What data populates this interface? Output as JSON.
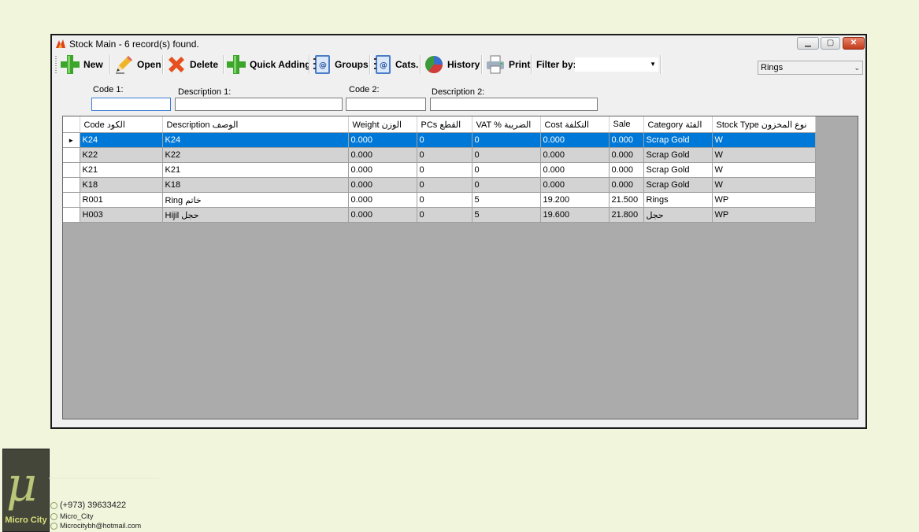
{
  "window": {
    "title": "Stock Main - 6 record(s) found."
  },
  "toolbar": {
    "new": "New",
    "open": "Open",
    "delete": "Delete",
    "quick_adding": "Quick Adding",
    "groups": "Groups",
    "cats": "Cats.",
    "history": "History",
    "print": "Print",
    "filter_by": "Filter by:",
    "filter_value": ""
  },
  "type_combo": {
    "value": "Rings"
  },
  "search": {
    "code1_label": "Code 1:",
    "desc1_label": "Description 1:",
    "code2_label": "Code 2:",
    "desc2_label": "Description 2:",
    "code1_value": "",
    "desc1_value": "",
    "code2_value": "",
    "desc2_value": ""
  },
  "grid": {
    "columns": [
      "Code الكود",
      "Description الوصف",
      "Weight الوزن",
      "PCs القطع",
      "VAT % الضريبة",
      "Cost التكلفة",
      "Sale",
      "Category الفئة",
      "Stock Type نوع المخزون"
    ],
    "rows": [
      [
        "K24",
        "K24",
        "0.000",
        "0",
        "0",
        "0.000",
        "0.000",
        "Scrap Gold",
        "W"
      ],
      [
        "K22",
        "K22",
        "0.000",
        "0",
        "0",
        "0.000",
        "0.000",
        "Scrap Gold",
        "W"
      ],
      [
        "K21",
        "K21",
        "0.000",
        "0",
        "0",
        "0.000",
        "0.000",
        "Scrap Gold",
        "W"
      ],
      [
        "K18",
        "K18",
        "0.000",
        "0",
        "0",
        "0.000",
        "0.000",
        "Scrap Gold",
        "W"
      ],
      [
        "R001",
        "Ring خاتم",
        "0.000",
        "0",
        "5",
        "19.200",
        "21.500",
        "Rings",
        "WP"
      ],
      [
        "H003",
        "Hijil حجل",
        "0.000",
        "0",
        "5",
        "19.600",
        "21.800",
        "حجل",
        "WP"
      ]
    ],
    "selected_row_marker": "►"
  },
  "branding": {
    "logo_symbol": "μ",
    "logo_name": "Micro City",
    "phone": "(+973) 39633422",
    "instagram": "Micro_City",
    "email": "Microcitybh@hotmail.com"
  },
  "colors": {
    "selection": "#0078d7",
    "background": "#f1f5dc",
    "grid_bg": "#ababab"
  }
}
